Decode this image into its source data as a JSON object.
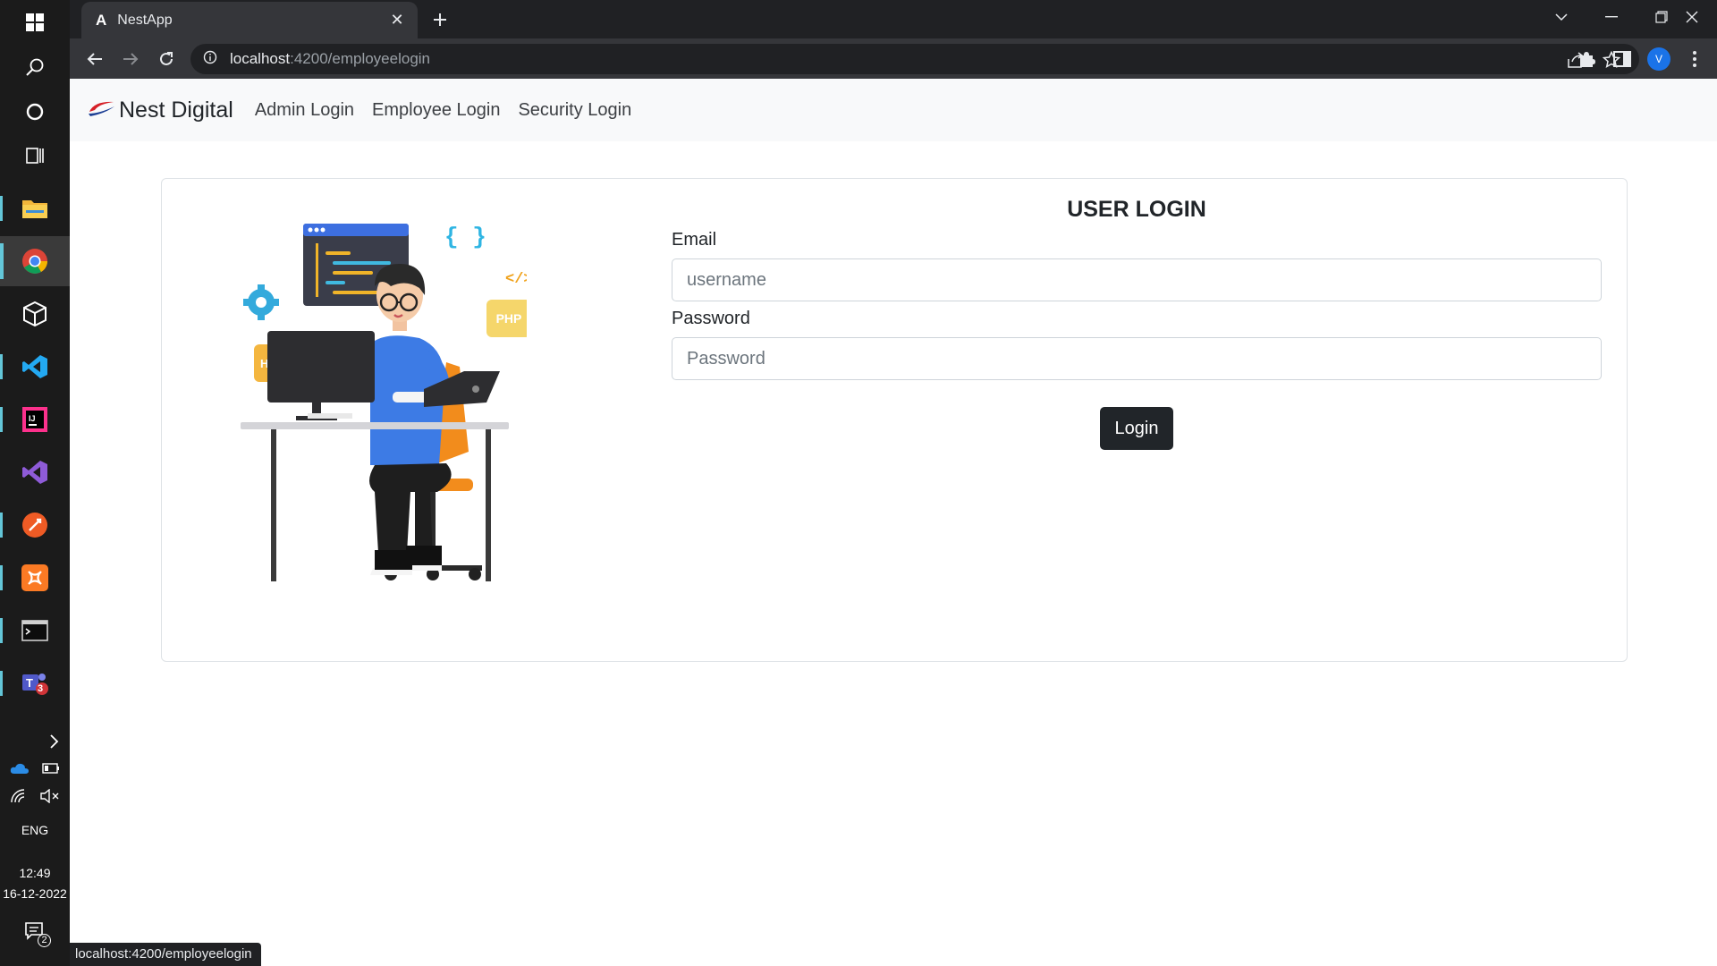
{
  "taskbar": {
    "system_icons": [
      "windows-icon",
      "search-icon",
      "cortana-icon",
      "task-view-icon"
    ],
    "apps": [
      "file-explorer",
      "chrome",
      "3d-cube-app",
      "vs-code",
      "intellij",
      "visual-studio",
      "postman",
      "xampp",
      "terminal",
      "teams"
    ],
    "teams_badge": "3",
    "language": "ENG",
    "time": "12:49",
    "date": "16-12-2022",
    "notifications_badge": "2"
  },
  "browser": {
    "tab_title": "NestApp",
    "tab_favicon": "A",
    "url_host": "localhost",
    "url_path": ":4200/employeelogin",
    "profile_initial": "V",
    "status_url": "localhost:4200/employeelogin"
  },
  "navbar": {
    "brand": "Nest Digital",
    "links": [
      "Admin Login",
      "Employee Login",
      "Security Login"
    ]
  },
  "login": {
    "title": "USER LOGIN",
    "email_label": "Email",
    "email_placeholder": "username",
    "password_label": "Password",
    "password_placeholder": "Password",
    "button": "Login"
  },
  "illustration": {
    "badges": [
      "HTML",
      "PHP"
    ],
    "symbols": [
      "{ }",
      "</>"
    ]
  },
  "colors": {
    "navbar_bg": "#f8f9fa",
    "button_bg": "#212529",
    "chrome_dark": "#202124",
    "taskbar_bg": "#1b1b1b",
    "accent_teal": "#63c6d8"
  }
}
